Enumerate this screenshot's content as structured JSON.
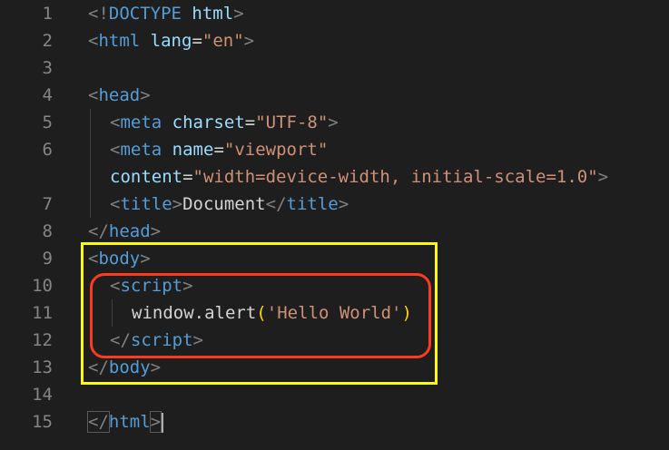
{
  "lines": [
    {
      "num": "1",
      "parts": [
        "<!",
        "DOCTYPE",
        " ",
        "html",
        ">"
      ]
    },
    {
      "num": "2",
      "parts": [
        "<",
        "html",
        " ",
        "lang",
        "=",
        "\"en\"",
        ">"
      ]
    },
    {
      "num": "3",
      "parts": []
    },
    {
      "num": "4",
      "parts": [
        "<",
        "head",
        ">"
      ]
    },
    {
      "num": "5",
      "parts": [
        "<",
        "meta",
        " ",
        "charset",
        "=",
        "\"UTF-8\"",
        ">"
      ]
    },
    {
      "num": "6",
      "parts": [
        "<",
        "meta",
        " ",
        "name",
        "=",
        "\"viewport\""
      ]
    },
    {
      "num": "",
      "parts": [
        "content",
        "=",
        "\"width=device-width, initial-scale=1.0\"",
        ">"
      ]
    },
    {
      "num": "7",
      "parts": [
        "<",
        "title",
        ">",
        "Document",
        "</",
        "title",
        ">"
      ]
    },
    {
      "num": "8",
      "parts": [
        "</",
        "head",
        ">"
      ]
    },
    {
      "num": "9",
      "parts": [
        "<",
        "body",
        ">"
      ]
    },
    {
      "num": "10",
      "parts": [
        "<",
        "script",
        ">"
      ]
    },
    {
      "num": "11",
      "parts": [
        "window",
        ".",
        "alert",
        "(",
        "'Hello World'",
        ")"
      ]
    },
    {
      "num": "12",
      "parts": [
        "</",
        "script",
        ">"
      ]
    },
    {
      "num": "13",
      "parts": [
        "</",
        "body",
        ">"
      ]
    },
    {
      "num": "14",
      "parts": []
    },
    {
      "num": "15",
      "parts": [
        "</",
        "html",
        ">"
      ]
    }
  ],
  "colors": {
    "highlight_outer": "#ffff00",
    "highlight_inner": "#ff3b1f"
  }
}
